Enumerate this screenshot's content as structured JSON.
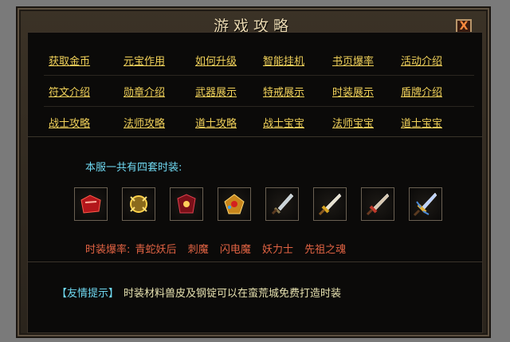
{
  "window": {
    "title": "游戏攻略",
    "close_label": "X"
  },
  "guide_links": [
    [
      "获取金币",
      "元宝作用",
      "如何升级",
      "智能挂机",
      "书页爆率",
      "活动介绍"
    ],
    [
      "符文介绍",
      "勋章介绍",
      "武器展示",
      "特戒展示",
      "时装展示",
      "盾牌介绍"
    ],
    [
      "战士攻略",
      "法师攻略",
      "道士攻略",
      "战士宝宝",
      "法师宝宝",
      "道士宝宝"
    ]
  ],
  "fashion": {
    "intro": "本服一共有四套时装:",
    "items": [
      "red-armor-icon",
      "gold-armor-icon",
      "crimson-armor-icon",
      "jeweled-armor-icon",
      "silver-blade-icon",
      "golden-blade-icon",
      "dragon-blade-icon",
      "winged-blade-icon"
    ],
    "drop_label": "时装爆率:",
    "drop_values": [
      "青蛇妖后",
      "刺魔",
      "闪电魔",
      "妖力士",
      "先祖之魂"
    ]
  },
  "tip": {
    "label": "【友情提示】",
    "text": "时装材料兽皮及钢锭可以在蛮荒城免费打造时装"
  },
  "colors": {
    "link": "#f2d25a",
    "intro": "#6fd9f2",
    "drop": "#e26343",
    "tip_text": "#e7e2b0"
  }
}
